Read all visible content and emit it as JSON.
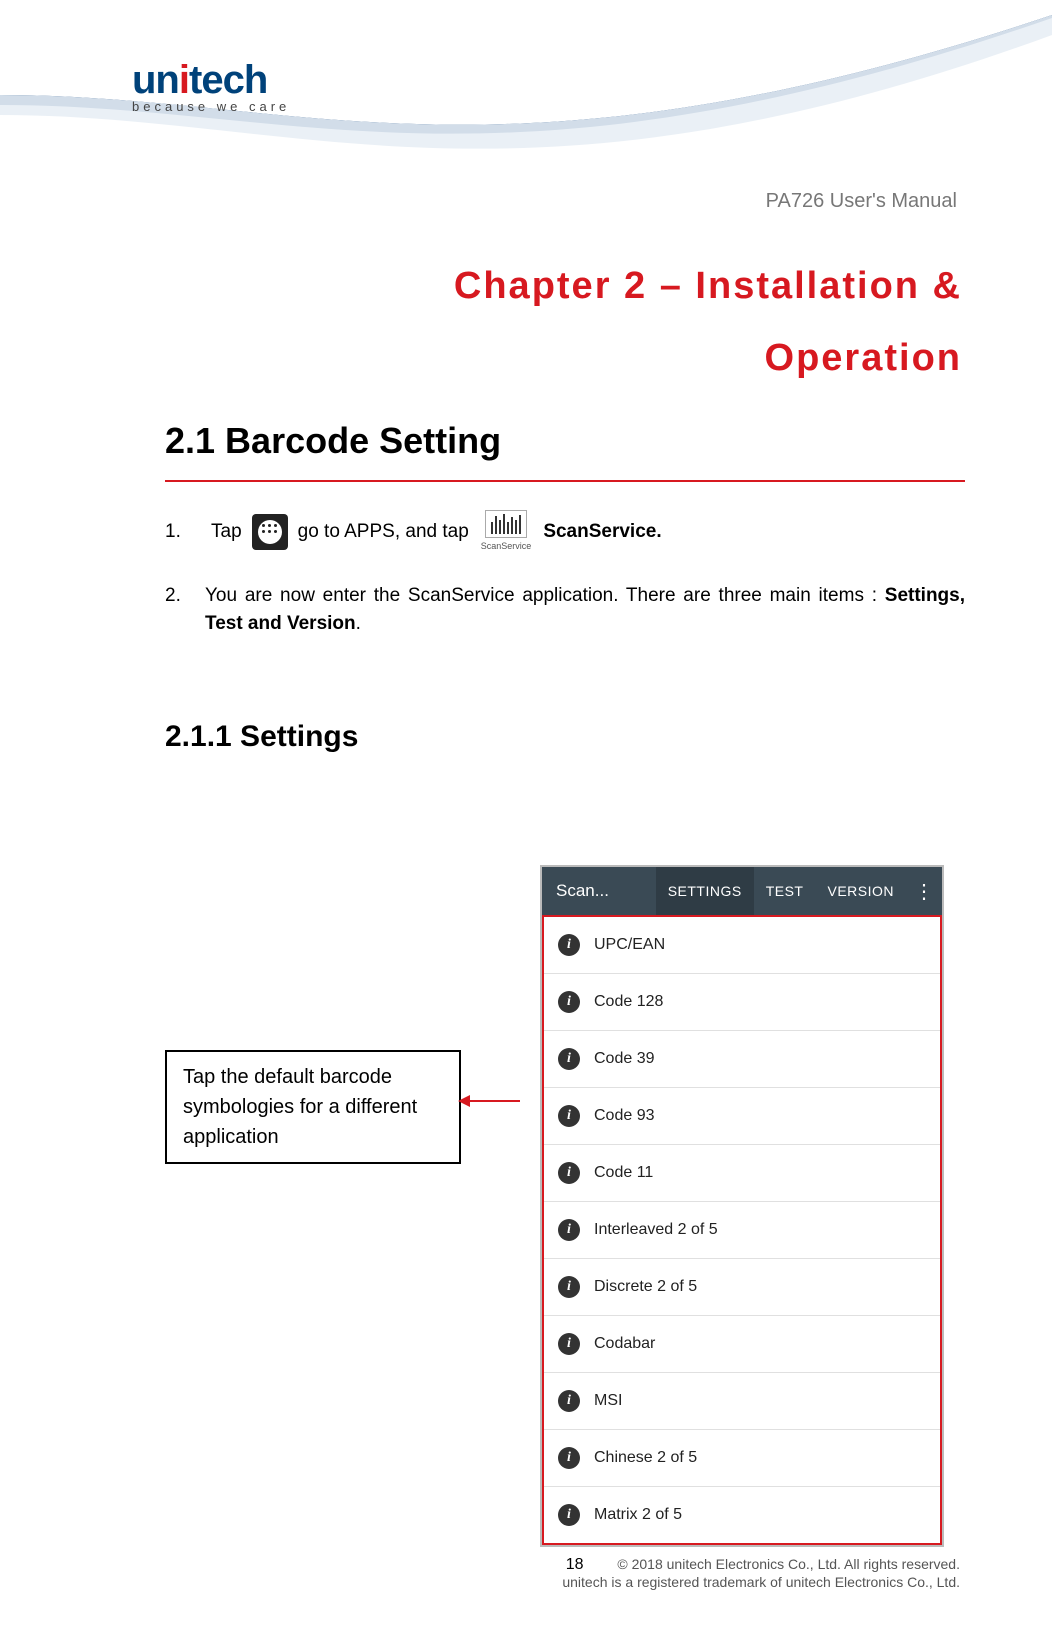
{
  "logo": {
    "part1": "un",
    "dot": "i",
    "part2": "tech",
    "tag": "because we care"
  },
  "doc_title": "PA726 User's Manual",
  "chapter": {
    "title": "Chapter 2 – Installation & Operation"
  },
  "section": {
    "number_title": "2.1 Barcode Setting"
  },
  "steps": {
    "s1_num": "1.",
    "s1_a": "Tap",
    "s1_b": "go to APPS, and tap",
    "s1_iconlabel": "ScanService",
    "s1_c": "ScanService.",
    "s2_num": "2.",
    "s2_txt_a": "You are now enter the ScanService application. There are three main items : ",
    "s2_txt_bold": "Settings, Test and Version",
    "s2_txt_end": "."
  },
  "subsection": {
    "title": "2.1.1 Settings"
  },
  "callout": {
    "text": "Tap the default barcode symbologies for a different application"
  },
  "phone": {
    "app_name": "Scan...",
    "tabs": [
      "SETTINGS",
      "TEST",
      "VERSION"
    ],
    "items": [
      "UPC/EAN",
      "Code 128",
      "Code 39",
      "Code 93",
      "Code 11",
      "Interleaved 2 of 5",
      "Discrete 2 of 5",
      "Codabar",
      "MSI",
      "Chinese 2 of 5",
      "Matrix 2 of 5"
    ]
  },
  "footer": {
    "page": "18",
    "line1": "© 2018 unitech Electronics Co., Ltd. All rights reserved.",
    "line2": "unitech is a registered trademark of unitech Electronics Co., Ltd."
  }
}
